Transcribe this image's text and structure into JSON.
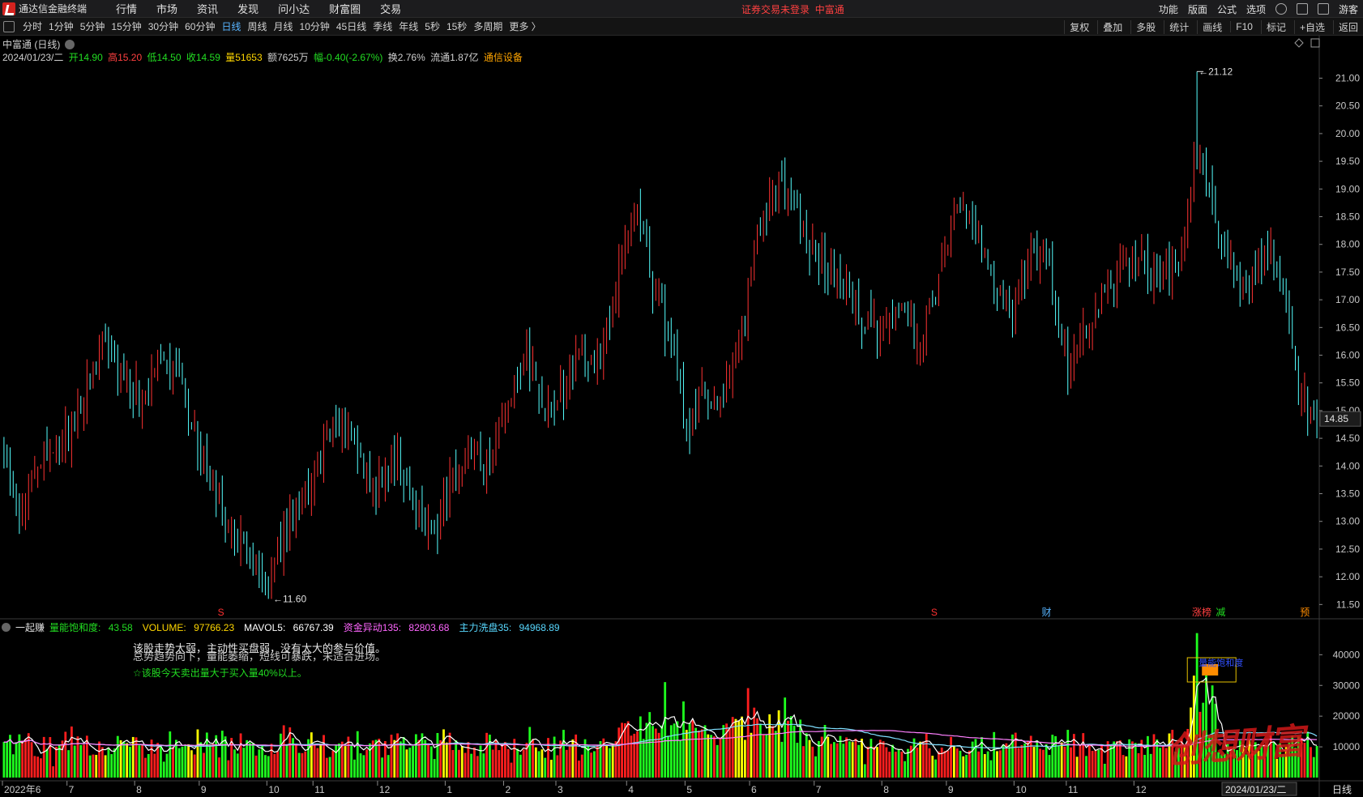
{
  "app": {
    "title": "通达信金融终端"
  },
  "menu": [
    "行情",
    "市场",
    "资讯",
    "发现",
    "问小达",
    "财富圈",
    "交易"
  ],
  "login_notice": "证券交易未登录",
  "login_broker": "中富通",
  "right_menu": [
    "功能",
    "版面",
    "公式",
    "选项"
  ],
  "guest": "游客",
  "periods": [
    "分时",
    "1分钟",
    "5分钟",
    "15分钟",
    "30分钟",
    "60分钟",
    "日线",
    "周线",
    "月线",
    "10分钟",
    "45日线",
    "季线",
    "年线",
    "5秒",
    "15秒",
    "多周期",
    "更多 〉"
  ],
  "active_period": "日线",
  "tools": [
    "复权",
    "叠加",
    "多股",
    "统计",
    "画线",
    "F10",
    "标记",
    "+自选",
    "返回"
  ],
  "stock": {
    "name_period": "中富通 (日线)",
    "date": "2024/01/23/二",
    "open_label": "开14.90",
    "high_label": "高15.20",
    "low_label": "低14.50",
    "close_label": "收14.59",
    "volume_label": "量51653",
    "amount_label": "额7625万",
    "change_label": "幅-0.40(-2.67%)",
    "turnover_label": "换2.76%",
    "float_label": "流通1.87亿",
    "industry": "通信设备"
  },
  "sub_panel": {
    "name": "一起赚",
    "saturation_label": "量能饱和度:",
    "saturation": "43.58",
    "volume_label": "VOLUME:",
    "volume": "97766.23",
    "mavol_label": "MAVOL5:",
    "mavol": "66767.39",
    "fund_label": "资金异动135:",
    "fund": "82803.68",
    "wash_label": "主力洗盘35:",
    "wash": "94968.89",
    "note1": "该股走势太弱，主动性买盘弱，没有太大的参与价值。",
    "note2": "总势趋势向下，量能萎缩，短线可暴跌，未适合进场。",
    "note3": "☆该股今天卖出量大于买入量40%以上。",
    "box_label": "量能饱和度"
  },
  "price_axis": [
    "21.00",
    "20.50",
    "20.00",
    "19.50",
    "19.00",
    "18.50",
    "18.00",
    "17.50",
    "17.00",
    "16.50",
    "16.00",
    "15.50",
    "15.00",
    "14.50",
    "14.00",
    "13.50",
    "13.00",
    "12.50",
    "12.00",
    "11.50"
  ],
  "current_price": "14.85",
  "volume_axis": [
    "40000",
    "30000",
    "20000",
    "10000"
  ],
  "max_label": "21.12",
  "min_label": "11.60",
  "x_axis": [
    "2022年6",
    "7",
    "8",
    "9",
    "10",
    "11",
    "12",
    "1",
    "2",
    "3",
    "4",
    "5",
    "6",
    "7",
    "8",
    "9",
    "10",
    "11",
    "12"
  ],
  "x_axis_last": "2024/01/23/二",
  "x_axis_period": "日线",
  "event_marks": [
    {
      "text": "S",
      "color": "#ff3030"
    },
    {
      "text": "S",
      "color": "#ff3030"
    },
    {
      "text": "财",
      "color": "#58b4ff"
    },
    {
      "text": "涨榜",
      "color": "#ff4040"
    },
    {
      "text": "减",
      "color": "#22dd22"
    },
    {
      "text": "预",
      "color": "#ff8c00"
    }
  ],
  "watermark": "创想财富",
  "colors": {
    "up": "#ff3232",
    "down": "#54ffff",
    "vol_up": "#ff1e1e",
    "vol_down": "#1eff1e",
    "vol_yellow": "#ffff00",
    "ma_cyan": "#7fdfff",
    "ma_pink": "#ff80ff",
    "ma_white": "#ffffff"
  },
  "chart_data": {
    "type": "candlestick",
    "series_note": "daily OHLC 2022-06 to 2024-01-23, approximated from screenshot",
    "ylim": [
      11.3,
      21.3
    ],
    "close_anchors": [
      [
        0,
        14.3
      ],
      [
        5,
        13.2
      ],
      [
        10,
        14.0
      ],
      [
        18,
        14.3
      ],
      [
        25,
        15.1
      ],
      [
        32,
        16.2
      ],
      [
        38,
        15.6
      ],
      [
        45,
        15.2
      ],
      [
        52,
        15.9
      ],
      [
        58,
        15.5
      ],
      [
        64,
        14.2
      ],
      [
        70,
        13.3
      ],
      [
        78,
        12.4
      ],
      [
        86,
        11.8
      ],
      [
        92,
        12.9
      ],
      [
        98,
        13.4
      ],
      [
        104,
        14.5
      ],
      [
        110,
        14.8
      ],
      [
        116,
        13.9
      ],
      [
        122,
        13.6
      ],
      [
        128,
        14.2
      ],
      [
        134,
        13.2
      ],
      [
        140,
        12.8
      ],
      [
        146,
        13.8
      ],
      [
        152,
        14.2
      ],
      [
        158,
        14.1
      ],
      [
        164,
        15.3
      ],
      [
        170,
        16.0
      ],
      [
        176,
        15.1
      ],
      [
        182,
        15.4
      ],
      [
        188,
        16.1
      ],
      [
        194,
        15.9
      ],
      [
        200,
        17.5
      ],
      [
        206,
        18.6
      ],
      [
        212,
        17.1
      ],
      [
        218,
        16.0
      ],
      [
        222,
        14.5
      ],
      [
        228,
        15.4
      ],
      [
        234,
        15.2
      ],
      [
        240,
        16.4
      ],
      [
        246,
        18.4
      ],
      [
        252,
        19.1
      ],
      [
        258,
        18.6
      ],
      [
        262,
        18.0
      ],
      [
        268,
        17.6
      ],
      [
        274,
        17.2
      ],
      [
        280,
        16.6
      ],
      [
        286,
        16.4
      ],
      [
        292,
        16.8
      ],
      [
        298,
        16.2
      ],
      [
        304,
        17.3
      ],
      [
        310,
        18.6
      ],
      [
        316,
        18.3
      ],
      [
        322,
        17.1
      ],
      [
        328,
        16.8
      ],
      [
        334,
        17.8
      ],
      [
        340,
        17.6
      ],
      [
        346,
        15.9
      ],
      [
        352,
        16.4
      ],
      [
        358,
        17.1
      ],
      [
        364,
        17.6
      ],
      [
        370,
        17.8
      ],
      [
        376,
        17.3
      ],
      [
        382,
        17.6
      ],
      [
        388,
        19.6
      ],
      [
        392,
        18.9
      ],
      [
        398,
        17.6
      ],
      [
        404,
        17.2
      ],
      [
        410,
        17.9
      ],
      [
        416,
        17.4
      ],
      [
        420,
        15.6
      ],
      [
        426,
        14.7
      ],
      [
        427,
        14.59
      ]
    ],
    "max": 21.12,
    "min": 11.6,
    "last_close": 14.59,
    "volume_ylim": [
      0,
      48000
    ]
  }
}
